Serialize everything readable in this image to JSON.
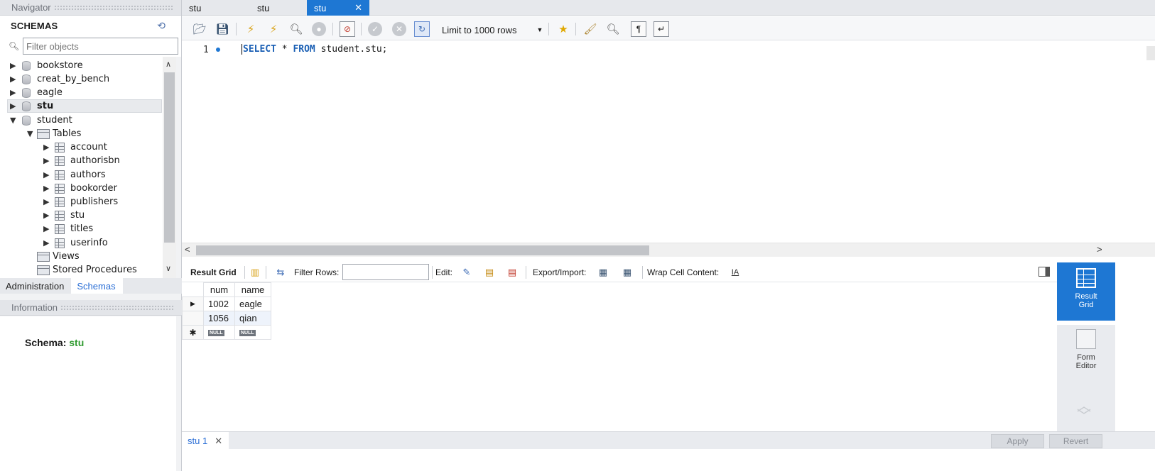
{
  "navigator": {
    "header": "Navigator",
    "schemas_title": "SCHEMAS",
    "filter_placeholder": "Filter objects",
    "tree": [
      {
        "label": "bookstore",
        "level": 0,
        "expanded": false,
        "bold": false
      },
      {
        "label": "creat_by_bench",
        "level": 0,
        "expanded": false,
        "bold": false
      },
      {
        "label": "eagle",
        "level": 0,
        "expanded": false,
        "bold": false
      },
      {
        "label": "stu",
        "level": 0,
        "expanded": false,
        "bold": true,
        "selected": true
      },
      {
        "label": "student",
        "level": 0,
        "expanded": true,
        "bold": false
      },
      {
        "label": "Tables",
        "level": 1,
        "expanded": true,
        "kind": "folder"
      },
      {
        "label": "account",
        "level": 2,
        "kind": "table"
      },
      {
        "label": "authorisbn",
        "level": 2,
        "kind": "table"
      },
      {
        "label": "authors",
        "level": 2,
        "kind": "table"
      },
      {
        "label": "bookorder",
        "level": 2,
        "kind": "table"
      },
      {
        "label": "publishers",
        "level": 2,
        "kind": "table"
      },
      {
        "label": "stu",
        "level": 2,
        "kind": "table"
      },
      {
        "label": "titles",
        "level": 2,
        "kind": "table"
      },
      {
        "label": "userinfo",
        "level": 2,
        "kind": "table"
      },
      {
        "label": "Views",
        "level": 1,
        "kind": "folder-leaf"
      },
      {
        "label": "Stored Procedures",
        "level": 1,
        "kind": "folder-leaf"
      }
    ],
    "tabs": [
      "Administration",
      "Schemas"
    ],
    "active_tab": "Schemas"
  },
  "information": {
    "header": "Information",
    "schema_label": "Schema:",
    "schema_value": "stu"
  },
  "query_tabs": [
    {
      "label": "stu",
      "active": false
    },
    {
      "label": "stu",
      "active": false
    },
    {
      "label": "stu",
      "active": true
    }
  ],
  "toolbar": {
    "limit_label": "Limit to 1000 rows"
  },
  "editor": {
    "line_number": "1",
    "kw1": "SELECT",
    "mid": " * ",
    "kw2": "FROM",
    "rest": " student.stu;"
  },
  "result_toolbar": {
    "result_grid": "Result Grid",
    "filter_rows": "Filter Rows:",
    "edit": "Edit:",
    "export_import": "Export/Import:",
    "wrap_cell": "Wrap Cell Content:"
  },
  "grid": {
    "columns": [
      "num",
      "name"
    ],
    "rows": [
      [
        "1002",
        "eagle"
      ],
      [
        "1056",
        "qian"
      ]
    ],
    "null_label": "NULL"
  },
  "side_panel": {
    "result_grid_line1": "Result",
    "result_grid_line2": "Grid",
    "form_editor_line1": "Form",
    "form_editor_line2": "Editor"
  },
  "bottom": {
    "result_tab": "stu 1",
    "apply": "Apply",
    "revert": "Revert"
  },
  "colors": {
    "accent": "#1e77d3",
    "schema_value": "#2f9a2f"
  }
}
